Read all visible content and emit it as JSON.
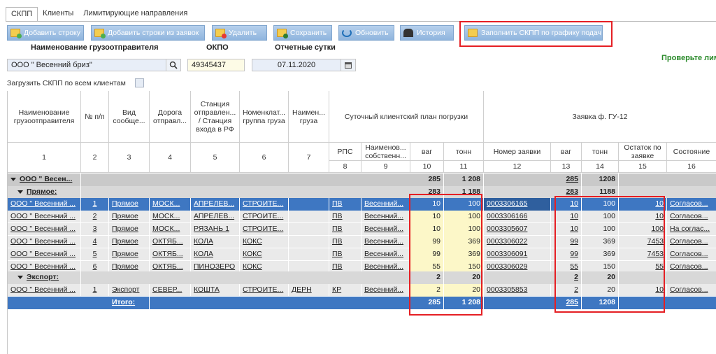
{
  "tabs": [
    "СКПП",
    "Клиенты",
    "Лимитирующие направления"
  ],
  "toolbar": {
    "add_row": "Добавить строку",
    "add_from_requests": "Добавить строки из заявок",
    "delete": "Удалить",
    "save": "Сохранить",
    "refresh": "Обновить",
    "history": "История",
    "fill_by_schedule": "Заполнить СКПП по графику подач"
  },
  "form": {
    "shipper_label": "Наименование грузоотправителя",
    "okpo_label": "ОКПО",
    "date_label": "Отчетные сутки",
    "shipper_value": "ООО \" Весенний бриз\"",
    "okpo_value": "49345437",
    "date_value": "07.11.2020",
    "load_all_label": "Загрузить СКПП по всем клиентам",
    "warning": "Проверьте лим"
  },
  "colors": {
    "accent": "#3e77c2",
    "highlight": "#e51f24",
    "yellow": "#fcf7c8"
  },
  "headers": {
    "c1": "Наименование грузоотправителя",
    "c2": "№ п/п",
    "c3": "Вид сообще...",
    "c4": "Дорога отправл...",
    "c5": "Станция отправлен... / Станция входа в РФ",
    "c6": "Номенклат... группа груза",
    "c7": "Наимен... груза",
    "plan_group": "Суточный клиентский план погрузки",
    "c8": "РПС",
    "c9": "Наименов... собственн...",
    "c10": "ваг",
    "c11": "тонн",
    "gu_group": "Заявка ф. ГУ-12",
    "c12": "Номер заявки",
    "c13": "ваг",
    "c14": "тонн",
    "c15": "Остаток по заявке",
    "c16": "Состояние",
    "nums": [
      "1",
      "2",
      "3",
      "4",
      "5",
      "6",
      "7",
      "8",
      "9",
      "10",
      "11",
      "12",
      "13",
      "14",
      "15",
      "16"
    ]
  },
  "groups": {
    "client": {
      "name": "ООО \" Весен...",
      "vag": "285",
      "ton": "1 208",
      "gu_vag": "285",
      "gu_ton": "1208"
    },
    "direct": {
      "name": "Прямое:",
      "vag": "283",
      "ton": "1 188",
      "gu_vag": "283",
      "gu_ton": "1188"
    },
    "export": {
      "name": "Экспорт:",
      "vag": "2",
      "ton": "20",
      "gu_vag": "2",
      "gu_ton": "20"
    }
  },
  "rows": [
    {
      "client": "ООО \" Весенний ...",
      "n": "1",
      "type": "Прямое",
      "road": "МОСК...",
      "station": "АПРЕЛЕВ...",
      "nom": "СТРОИТЕ...",
      "cargo": "",
      "rps": "ПВ",
      "owner": "Весенний...",
      "vag": "10",
      "ton": "100",
      "req": "0003306165",
      "gvag": "10",
      "gton": "100",
      "rest": "10",
      "state": "Согласов..."
    },
    {
      "client": "ООО \" Весенний ...",
      "n": "2",
      "type": "Прямое",
      "road": "МОСК...",
      "station": "АПРЕЛЕВ...",
      "nom": "СТРОИТЕ...",
      "cargo": "",
      "rps": "ПВ",
      "owner": "Весенний...",
      "vag": "10",
      "ton": "100",
      "req": "0003306166",
      "gvag": "10",
      "gton": "100",
      "rest": "10",
      "state": "Согласов..."
    },
    {
      "client": "ООО \" Весенний ...",
      "n": "3",
      "type": "Прямое",
      "road": "МОСК...",
      "station": "РЯЗАНЬ 1",
      "nom": "СТРОИТЕ...",
      "cargo": "",
      "rps": "ПВ",
      "owner": "Весенний...",
      "vag": "10",
      "ton": "100",
      "req": "0003305607",
      "gvag": "10",
      "gton": "100",
      "rest": "100",
      "state": "На соглас..."
    },
    {
      "client": "ООО \" Весенний ...",
      "n": "4",
      "type": "Прямое",
      "road": "ОКТЯБ...",
      "station": "КОЛА",
      "nom": "КОКС",
      "cargo": "",
      "rps": "ПВ",
      "owner": "Весенний...",
      "vag": "99",
      "ton": "369",
      "req": "0003306022",
      "gvag": "99",
      "gton": "369",
      "rest": "7453",
      "state": "Согласов..."
    },
    {
      "client": "ООО \" Весенний ...",
      "n": "5",
      "type": "Прямое",
      "road": "ОКТЯБ...",
      "station": "КОЛА",
      "nom": "КОКС",
      "cargo": "",
      "rps": "ПВ",
      "owner": "Весенний...",
      "vag": "99",
      "ton": "369",
      "req": "0003306091",
      "gvag": "99",
      "gton": "369",
      "rest": "7453",
      "state": "Согласов..."
    },
    {
      "client": "ООО \" Весенний ...",
      "n": "6",
      "type": "Прямое",
      "road": "ОКТЯБ...",
      "station": "ПИНОЗЕРО",
      "nom": "КОКС",
      "cargo": "",
      "rps": "ПВ",
      "owner": "Весенний...",
      "vag": "55",
      "ton": "150",
      "req": "0003306029",
      "gvag": "55",
      "gton": "150",
      "rest": "55",
      "state": "Согласов..."
    },
    {
      "client": "ООО \" Весенний ...",
      "n": "1",
      "type": "Экспорт",
      "road": "СЕВЕР...",
      "station": "КОШТА",
      "nom": "СТРОИТЕ...",
      "cargo": "ДЕРН",
      "rps": "КР",
      "owner": "Весенний...",
      "vag": "2",
      "ton": "20",
      "req": "0003305853",
      "gvag": "2",
      "gton": "20",
      "rest": "10",
      "state": "Согласов..."
    }
  ],
  "total": {
    "label": "Итого:",
    "vag": "285",
    "ton": "1 208",
    "gu_vag": "285",
    "gu_ton": "1208"
  }
}
